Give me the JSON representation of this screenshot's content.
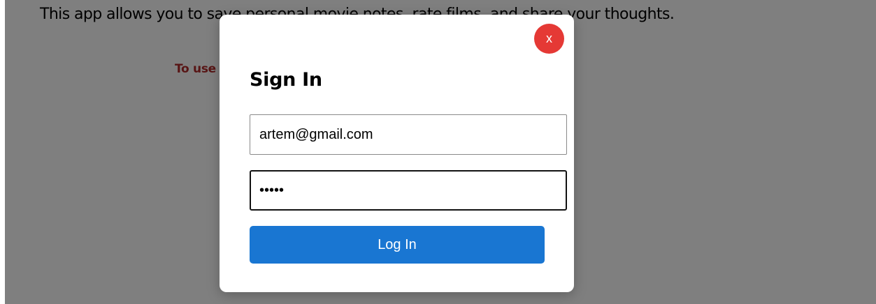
{
  "page": {
    "intro_text": "This app allows you to save personal movie notes, rate films, and share your thoughts.",
    "notice_text": "To use this app, please register or sign in."
  },
  "modal": {
    "close_label": "x",
    "title": "Sign In",
    "email_value": "artem@gmail.com",
    "password_value": "12345",
    "login_label": "Log In"
  },
  "colors": {
    "overlay": "#808080",
    "close_button": "#e53935",
    "login_button": "#1976d2",
    "notice_text": "#b02a2a"
  }
}
